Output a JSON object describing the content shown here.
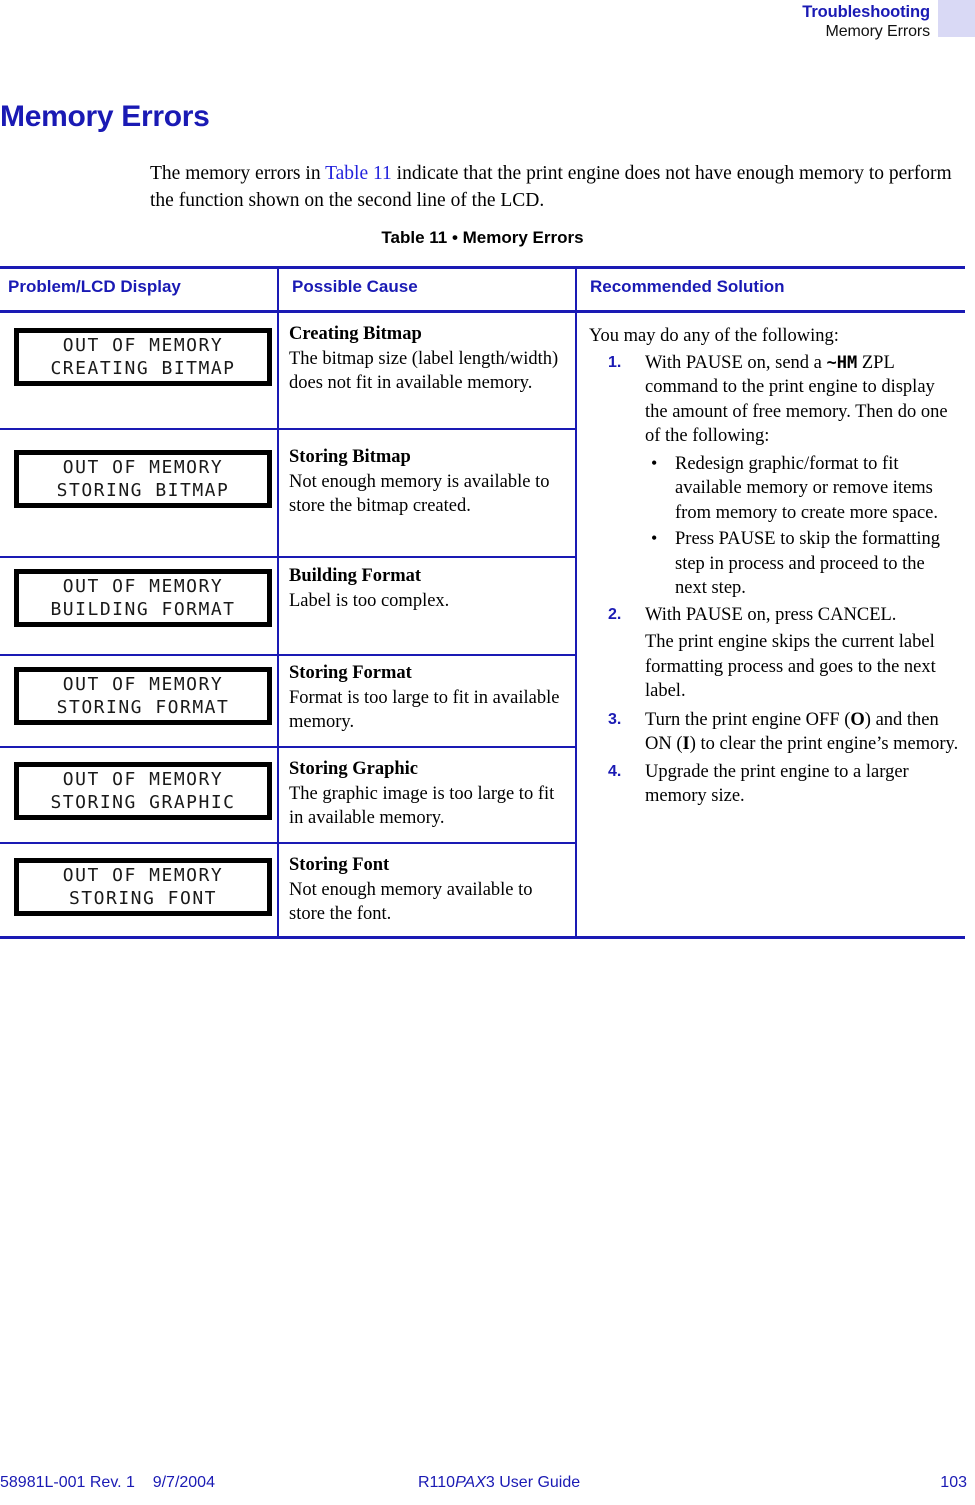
{
  "header": {
    "chapter": "Troubleshooting",
    "section": "Memory Errors",
    "accent_color": "#d9d9f5"
  },
  "page_title": "Memory Errors",
  "intro": {
    "before_xref": "The memory errors in ",
    "xref": "Table 11",
    "after_xref": " indicate that the print engine does not have enough memory to perform the function shown on the second line of the LCD."
  },
  "table": {
    "caption": "Table 11 • Memory Errors",
    "accent_color": "#1a1ab4",
    "columns": [
      "Problem/LCD Display",
      "Possible Cause",
      "Recommended Solution"
    ],
    "rows": [
      {
        "lcd_line1": "OUT OF MEMORY",
        "lcd_line2": "CREATING BITMAP",
        "cause_title": "Creating Bitmap",
        "cause_body": "The bitmap size (label length/width) does not fit in available memory."
      },
      {
        "lcd_line1": "OUT OF MEMORY",
        "lcd_line2": "STORING BITMAP",
        "cause_title": "Storing Bitmap",
        "cause_body": "Not enough memory is available to store the bitmap created."
      },
      {
        "lcd_line1": "OUT OF MEMORY",
        "lcd_line2": "BUILDING FORMAT",
        "cause_title": "Building Format",
        "cause_body": "Label is too complex."
      },
      {
        "lcd_line1": "OUT OF MEMORY",
        "lcd_line2": "STORING FORMAT",
        "cause_title": "Storing Format",
        "cause_body": "Format is too large to fit in available memory."
      },
      {
        "lcd_line1": "OUT OF MEMORY",
        "lcd_line2": "STORING GRAPHIC",
        "cause_title": "Storing Graphic",
        "cause_body": "The graphic image is too large to fit in available memory."
      },
      {
        "lcd_line1": "OUT OF MEMORY",
        "lcd_line2": "STORING FONT",
        "cause_title": "Storing Font",
        "cause_body": "Not enough memory available to store the font."
      }
    ],
    "solution": {
      "lead": "You may do any of the following:",
      "step1_num": "1.",
      "step1_a": "With PAUSE on, send a ",
      "step1_code": "~HM",
      "step1_b": " ZPL command to the print engine to display the amount of free memory. Then do one of the following:",
      "bullet_marker": "•",
      "bullet1": "Redesign graphic/format to fit available memory or remove items from memory to create more space.",
      "bullet2": "Press PAUSE to skip the formatting step in process and proceed to the next step.",
      "step2_num": "2.",
      "step2": "With PAUSE on, press CANCEL.",
      "step2_note": "The print engine skips the current label formatting process and goes to the next label.",
      "step3_num": "3.",
      "step3_a": "Turn the print engine OFF (",
      "step3_off": "O",
      "step3_b": ") and then ON (",
      "step3_on": "I",
      "step3_c": ") to clear the print engine’s memory.",
      "step4_num": "4.",
      "step4": "Upgrade the print engine to a larger memory size."
    }
  },
  "footer": {
    "left": "58981L-001 Rev. 1    9/7/2004",
    "center_pre": "R110",
    "center_italic": "PAX",
    "center_post": "3 User Guide",
    "page_number": "103"
  }
}
